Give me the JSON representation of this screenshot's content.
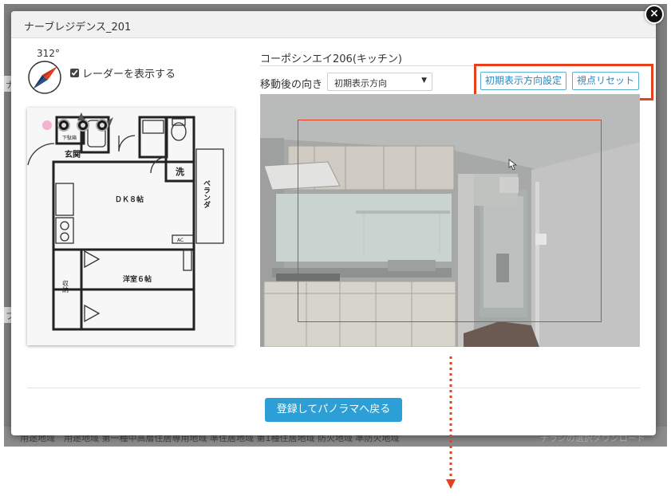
{
  "background": {
    "strip_text_1": "ナ",
    "strip_text_2": "フ",
    "bottom_text": "用途地域　用途地域 第一種中高層住居専用地域 準住居地域 第1種住居地域 防火地域 準防火地域",
    "bottom_link": "チラシの選択ダウンロード"
  },
  "modal": {
    "title": "ナーブレジデンス_201",
    "close_label": "×"
  },
  "radar": {
    "degree": "312°",
    "show_radar_label": "レーダーを表示する",
    "show_radar_checked": true
  },
  "floorplan": {
    "labels": {
      "genkan": "玄関",
      "getabako": "下駄箱",
      "wash": "洗",
      "dk": "ＤＫ８帖",
      "veranda": "ベランダ",
      "ac": "AC",
      "western": "洋室６帖",
      "storage": "収納"
    }
  },
  "viewer": {
    "room_title": "コーポシンエイ206(キッチン)",
    "direction_label": "移動後の向き",
    "direction_selected": "初期表示方向",
    "set_initial_button": "初期表示方向設定",
    "reset_button": "視点リセット"
  },
  "footer": {
    "save_button": "登録してパノラマへ戻る"
  },
  "colors": {
    "accent": "#2b9fd6",
    "highlight": "#e8401c",
    "outline_button": "#2a87bd"
  }
}
